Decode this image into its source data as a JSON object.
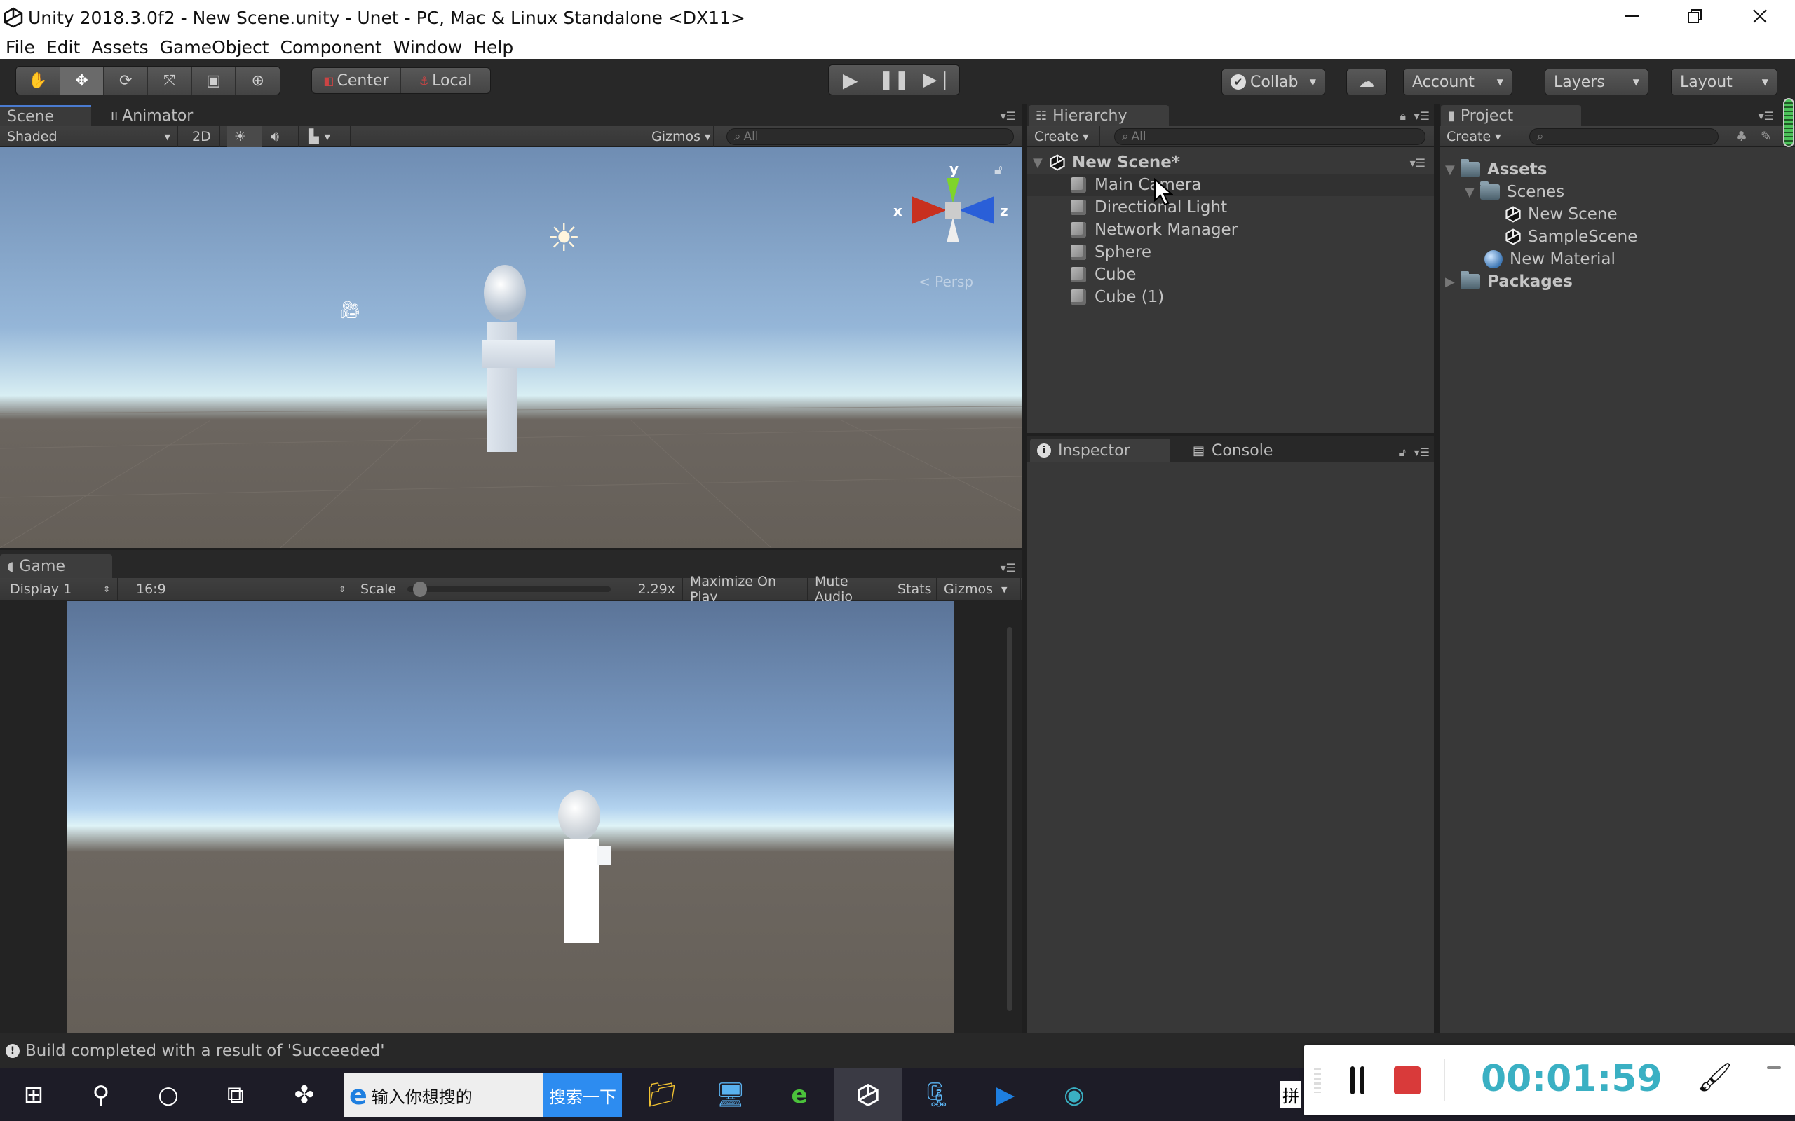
{
  "window": {
    "title": "Unity 2018.3.0f2 - New Scene.unity - Unet - PC, Mac & Linux Standalone <DX11>",
    "controls": [
      "minimize-icon",
      "restore-icon",
      "close-icon"
    ]
  },
  "menu": [
    "File",
    "Edit",
    "Assets",
    "GameObject",
    "Component",
    "Window",
    "Help"
  ],
  "toolbar": {
    "transform_tools": [
      "hand-tool-icon",
      "move-tool-icon",
      "rotate-tool-icon",
      "scale-tool-icon",
      "rect-tool-icon",
      "transform-tool-icon"
    ],
    "active_tool": "move-tool-icon",
    "pivot_mode": "Center",
    "pivot_rotation": "Local",
    "play_controls": [
      "play-icon",
      "pause-icon",
      "step-icon"
    ],
    "collab": "Collab",
    "account": "Account",
    "layers": "Layers",
    "layout": "Layout"
  },
  "scene_panel": {
    "tabs": [
      "Scene",
      "Animator"
    ],
    "active_tab": "Scene",
    "draw_mode": "Shaded",
    "mode_2d": "2D",
    "gizmos": "Gizmos",
    "search_placeholder": "All",
    "gizmo_axes": {
      "x": "x",
      "y": "y",
      "z": "z"
    },
    "projection": "Persp"
  },
  "game_panel": {
    "tab": "Game",
    "display": "Display 1",
    "aspect": "16:9",
    "scale_label": "Scale",
    "scale_value": "2.29x",
    "maximize_on_play": "Maximize On Play",
    "mute_audio": "Mute Audio",
    "stats": "Stats",
    "gizmos": "Gizmos"
  },
  "hierarchy": {
    "tab": "Hierarchy",
    "create": "Create",
    "search_placeholder": "All",
    "scene_name": "New Scene*",
    "items": [
      "Main Camera",
      "Directional Light",
      "Network Manager",
      "Sphere",
      "Cube",
      "Cube (1)"
    ],
    "hovered": "Main Camera"
  },
  "inspector": {
    "tabs": [
      "Inspector",
      "Console"
    ],
    "active_tab": "Inspector"
  },
  "project": {
    "tab": "Project",
    "create": "Create",
    "tree": [
      {
        "label": "Assets",
        "bold": true,
        "expanded": true,
        "icon": "folder-icon",
        "depth": 0
      },
      {
        "label": "Scenes",
        "bold": false,
        "expanded": true,
        "icon": "folder-icon",
        "depth": 1
      },
      {
        "label": "New Scene",
        "bold": false,
        "icon": "unity-scene-icon",
        "depth": 2
      },
      {
        "label": "SampleScene",
        "bold": false,
        "icon": "unity-scene-icon",
        "depth": 2
      },
      {
        "label": "New Material",
        "bold": false,
        "icon": "material-sphere-icon",
        "depth": 1
      },
      {
        "label": "Packages",
        "bold": true,
        "expanded": false,
        "icon": "folder-icon",
        "depth": 0
      }
    ]
  },
  "status": {
    "message": "Build completed with a result of 'Succeeded'"
  },
  "taskbar": {
    "search_text": "输入你想搜的",
    "search_button": "搜索一下",
    "ime": "拼"
  },
  "recorder": {
    "time": "00:01:59",
    "accent": "#3ab0c3",
    "stop_color": "#d93a3a"
  }
}
